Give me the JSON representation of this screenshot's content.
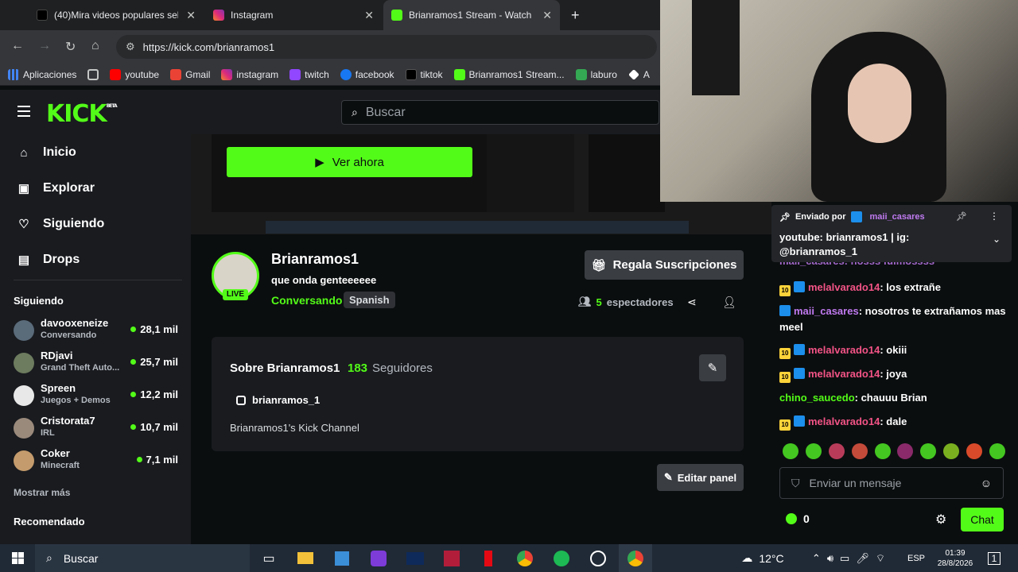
{
  "browser": {
    "tabs": [
      {
        "label": "(40)Mira videos populares selec",
        "active": false
      },
      {
        "label": "Instagram",
        "active": false
      },
      {
        "label": "Brianramos1 Stream - Watch Li",
        "active": true
      }
    ],
    "url_host": "https://kick.com/brianramos1",
    "bookmarks": [
      "Aplicaciones",
      "youtube",
      "Gmail",
      "instagram",
      "twitch",
      "facebook",
      "tiktok",
      "Brianramos1 Stream...",
      "laburo",
      "A"
    ]
  },
  "kick": {
    "logo": "KICK",
    "logo_beta": "BETA",
    "search_placeholder": "Buscar",
    "nav": [
      "Inicio",
      "Explorar",
      "Siguiendo",
      "Drops"
    ],
    "following_title": "Siguiendo",
    "following": [
      {
        "name": "davooxeneize",
        "category": "Conversando",
        "viewers": "28,1 mil"
      },
      {
        "name": "RDjavi",
        "category": "Grand Theft Auto...",
        "viewers": "25,7 mil"
      },
      {
        "name": "Spreen",
        "category": "Juegos + Demos",
        "viewers": "12,2 mil"
      },
      {
        "name": "Cristorata7",
        "category": "IRL",
        "viewers": "10,7 mil"
      },
      {
        "name": "Coker",
        "category": "Minecraft",
        "viewers": "7,1 mil"
      }
    ],
    "show_more": "Mostrar más",
    "recommended_title": "Recomendado",
    "watch_now": "Ver ahora",
    "channel": {
      "name": "Brianramos1",
      "title": "que onda genteeeeee",
      "category": "Conversando",
      "language": "Spanish",
      "live": "LIVE",
      "gift": "Regala Suscripciones",
      "viewers_count": "5",
      "viewers_label": "espectadores"
    },
    "about": {
      "title": "Sobre Brianramos1",
      "followers": "183",
      "followers_label": "Seguidores",
      "instagram": "brianramos_1",
      "bio": "Brianramos1's Kick Channel",
      "edit_panel": "Editar panel"
    },
    "chat": {
      "pinned_by_label": "Enviado por",
      "pinned_by": "maii_casares",
      "pinned_text": "youtube: brianramos1 | ig: @brianramos_1",
      "messages": [
        {
          "user": "melalvarado14",
          "text": ": los extrañe",
          "color": "#f35487"
        },
        {
          "user": "maii_casares",
          "text": ": nosotros te extrañamos mas meel",
          "color": "#c07af0"
        },
        {
          "user": "melalvarado14",
          "text": ": okiii",
          "color": "#f35487"
        },
        {
          "user": "melalvarado14",
          "text": ": joya",
          "color": "#f35487"
        },
        {
          "user": "chino_saucedo",
          "text": ": chauuu Brian",
          "color": "#53fc18"
        },
        {
          "user": "melalvarado14",
          "text": ": dale",
          "color": "#f35487"
        }
      ],
      "partial_top": "maii_casares: nosss fuimossss",
      "input_placeholder": "Enviar un mensaje",
      "points": "0",
      "send": "Chat"
    }
  },
  "taskbar": {
    "search": "Buscar",
    "temperature": "12°C",
    "lang": "ESP",
    "time": "01:39",
    "date": "28/8/2026",
    "notif": "1"
  }
}
